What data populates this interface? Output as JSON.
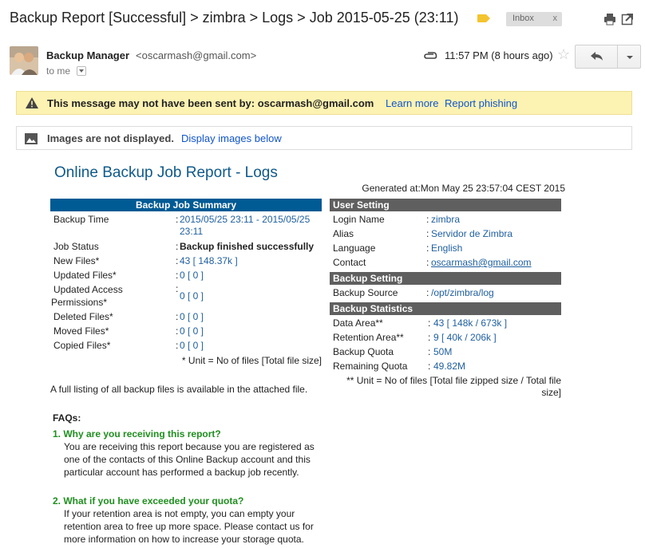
{
  "subject": {
    "title": "Backup Report [Successful] > zimbra > Logs > Job 2015-05-25 (23:11)",
    "label_chip": "Inbox",
    "label_chip_close": "x"
  },
  "sender": {
    "name": "Backup Manager",
    "email": "<oscarmash@gmail.com>",
    "to": "to me",
    "timestamp": "11:57 PM (8 hours ago)"
  },
  "warning": {
    "text": "This message may not have been sent by: oscarmash@gmail.com",
    "learn_more": "Learn more",
    "report_phishing": "Report phishing"
  },
  "images": {
    "text": "Images are not displayed.",
    "link": "Display images below"
  },
  "report": {
    "title": "Online Backup Job Report  - Logs",
    "generated": "Generated at:Mon May 25 23:57:04 CEST 2015"
  },
  "summary": {
    "header": "Backup Job Summary",
    "rows": [
      {
        "label": "Backup Time",
        "colon": ":",
        "value": "2015/05/25 23:11 - 2015/05/25 23:11"
      },
      {
        "label": "Job Status",
        "colon": ":",
        "value": "Backup finished successfully"
      },
      {
        "label": "New Files*",
        "colon": ":",
        "value": "43 [ 148.37k ]"
      },
      {
        "label": "Updated Files*",
        "colon": ":",
        "value": "0 [ 0 ]"
      },
      {
        "label": "Updated Access",
        "label2": "Permissions*",
        "colon": ":",
        "value": "0 [ 0 ]"
      },
      {
        "label": "Deleted Files*",
        "colon": ":",
        "value": "0 [ 0 ]"
      },
      {
        "label": "Moved Files*",
        "colon": ":",
        "value": "0 [ 0 ]"
      },
      {
        "label": "Copied Files*",
        "colon": ":",
        "value": "0 [ 0 ]"
      }
    ],
    "footnote": "* Unit = No of files [Total file size]"
  },
  "user_setting": {
    "header": "User Setting",
    "rows": [
      {
        "label": "Login Name",
        "colon": ":",
        "value": "zimbra"
      },
      {
        "label": "Alias",
        "colon": ":",
        "value": "Servidor de Zimbra"
      },
      {
        "label": "Language",
        "colon": ":",
        "value": "English"
      },
      {
        "label": "Contact",
        "colon": ":",
        "value": "oscarmash@gmail.com"
      }
    ]
  },
  "backup_setting": {
    "header": "Backup Setting",
    "rows": [
      {
        "label": "Backup Source",
        "colon": ":",
        "value": "/opt/zimbra/log"
      }
    ]
  },
  "backup_statistics": {
    "header": "Backup Statistics",
    "rows": [
      {
        "label": "Data Area**",
        "colon": ":",
        "value": "43 [ 148k / 673k ]"
      },
      {
        "label": "Retention Area**",
        "colon": ":",
        "value": "9 [ 40k / 206k ]"
      },
      {
        "label": "Backup Quota",
        "colon": ":",
        "value": "50M"
      },
      {
        "label": "Remaining Quota",
        "colon": ":",
        "value": "49.82M"
      }
    ],
    "footnote": "** Unit = No of files [Total file zipped size / Total file size]"
  },
  "listing_note": "A full listing of all backup files is available in the attached file.",
  "faqs": {
    "title": "FAQs:",
    "items": [
      {
        "question": "1. Why are you receiving this report?",
        "answer": "You are receiving this report because you are registered as one of the contacts of this Online Backup account and this particular account has performed a backup job recently."
      },
      {
        "question": "2. What if you have exceeded your quota?",
        "answer": "If your retention area is not empty, you can empty your retention area to free up more space. Please contact us for more information on how to increase your storage quota."
      }
    ]
  },
  "colors": {
    "summary_header": "#005a94",
    "setting_header": "#5f5f5f",
    "link": "#1155cc",
    "faq_question": "#1f8f1f",
    "warning_bg": "#fcf2b2",
    "report_title": "#0f5a8a"
  },
  "icons": [
    "label-tag-icon",
    "print-icon",
    "new-window-icon",
    "paperclip-icon",
    "star-icon",
    "reply-icon",
    "warning-icon",
    "image-icon"
  ]
}
